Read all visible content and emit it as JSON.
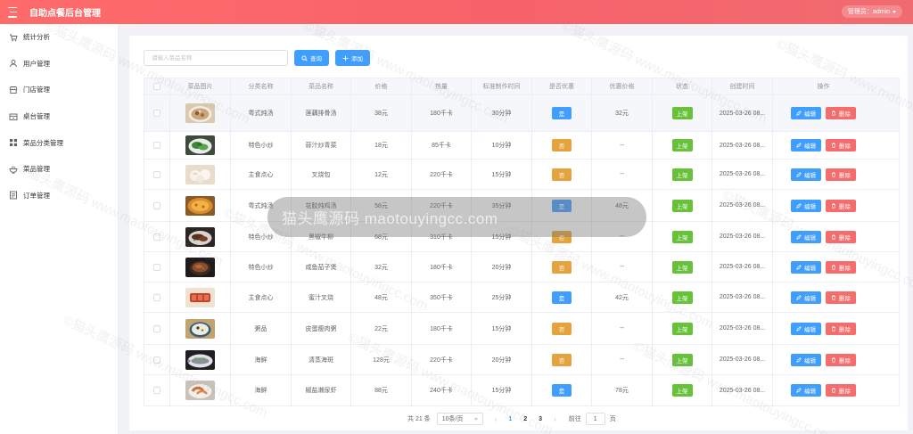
{
  "header": {
    "title": "自助点餐后台管理",
    "admin_label": "管理员：admin"
  },
  "sidebar": {
    "items": [
      {
        "label": "统计分析",
        "icon": "cart-icon"
      },
      {
        "label": "用户管理",
        "icon": "user-icon"
      },
      {
        "label": "门店管理",
        "icon": "store-icon"
      },
      {
        "label": "桌台管理",
        "icon": "table-icon"
      },
      {
        "label": "菜品分类管理",
        "icon": "grid-icon"
      },
      {
        "label": "菜品管理",
        "icon": "bowl-icon"
      },
      {
        "label": "订单管理",
        "icon": "order-icon"
      }
    ]
  },
  "toolbar": {
    "search_placeholder": "请输入菜品名称",
    "query_label": "查询",
    "add_label": "添加"
  },
  "table": {
    "headers": [
      "",
      "菜品图片",
      "分类名称",
      "菜品名称",
      "价格",
      "热量",
      "标准制作时间",
      "是否优惠",
      "优惠价格",
      "状态",
      "创建时间",
      "操作"
    ],
    "edit_label": "编辑",
    "delete_label": "删除",
    "rows": [
      {
        "category": "粤式炖汤",
        "name": "莲藕排骨汤",
        "price": "38元",
        "calories": "180千卡",
        "time": "30分钟",
        "discount": "是",
        "discount_price": "32元",
        "status": "上架",
        "created": "2025-03-26 08...",
        "image": "soup-bowl"
      },
      {
        "category": "特色小炒",
        "name": "蒜汁炒青菜",
        "price": "18元",
        "calories": "85千卡",
        "time": "10分钟",
        "discount": "否",
        "discount_price": "--",
        "status": "上架",
        "created": "2025-03-26 08...",
        "image": "greens-plate"
      },
      {
        "category": "主食点心",
        "name": "叉烧包",
        "price": "12元",
        "calories": "220千卡",
        "time": "15分钟",
        "discount": "否",
        "discount_price": "--",
        "status": "上架",
        "created": "2025-03-26 08...",
        "image": "buns"
      },
      {
        "category": "粤式炖汤",
        "name": "花胶炖鸡汤",
        "price": "58元",
        "calories": "220千卡",
        "time": "35分钟",
        "discount": "是",
        "discount_price": "48元",
        "status": "上架",
        "created": "2025-03-26 08...",
        "image": "golden-dish"
      },
      {
        "category": "特色小炒",
        "name": "黑椒牛柳",
        "price": "68元",
        "calories": "310千卡",
        "time": "15分钟",
        "discount": "否",
        "discount_price": "--",
        "status": "上架",
        "created": "2025-03-26 08...",
        "image": "beef-plate"
      },
      {
        "category": "特色小炒",
        "name": "咸鱼茄子煲",
        "price": "32元",
        "calories": "180千卡",
        "time": "20分钟",
        "discount": "否",
        "discount_price": "--",
        "status": "上架",
        "created": "2025-03-26 08...",
        "image": "clay-pot"
      },
      {
        "category": "主食点心",
        "name": "蜜汁叉烧",
        "price": "48元",
        "calories": "350千卡",
        "time": "25分钟",
        "discount": "是",
        "discount_price": "42元",
        "status": "上架",
        "created": "2025-03-26 08...",
        "image": "char-siu"
      },
      {
        "category": "粥品",
        "name": "皮蛋瘦肉粥",
        "price": "22元",
        "calories": "180千卡",
        "time": "15分钟",
        "discount": "否",
        "discount_price": "--",
        "status": "上架",
        "created": "2025-03-26 08...",
        "image": "congee"
      },
      {
        "category": "海鲜",
        "name": "清蒸海斑",
        "price": "128元",
        "calories": "220千卡",
        "time": "20分钟",
        "discount": "否",
        "discount_price": "--",
        "status": "上架",
        "created": "2025-03-26 08...",
        "image": "steamed-fish"
      },
      {
        "category": "海鲜",
        "name": "椒盐濑尿虾",
        "price": "88元",
        "calories": "240千卡",
        "time": "15分钟",
        "discount": "是",
        "discount_price": "78元",
        "status": "上架",
        "created": "2025-03-26 08...",
        "image": "shrimp"
      }
    ]
  },
  "pager": {
    "total": "共 21 条",
    "page_size": "10条/页",
    "pages": [
      "1",
      "2",
      "3"
    ],
    "current": "1",
    "goto_label": "前往",
    "goto_value": "1",
    "goto_unit": "页"
  },
  "watermark": {
    "band_text": "猫头鹰源码 maotouyingcc.com",
    "tile_text": "©猫头鹰源码 www.maotouyingcc.com"
  },
  "colors": {
    "header_start": "#ff6b6b",
    "header_end": "#f06b70",
    "primary": "#409eff",
    "warning": "#e6a23c",
    "success": "#67c23a",
    "danger": "#f56c6c"
  }
}
